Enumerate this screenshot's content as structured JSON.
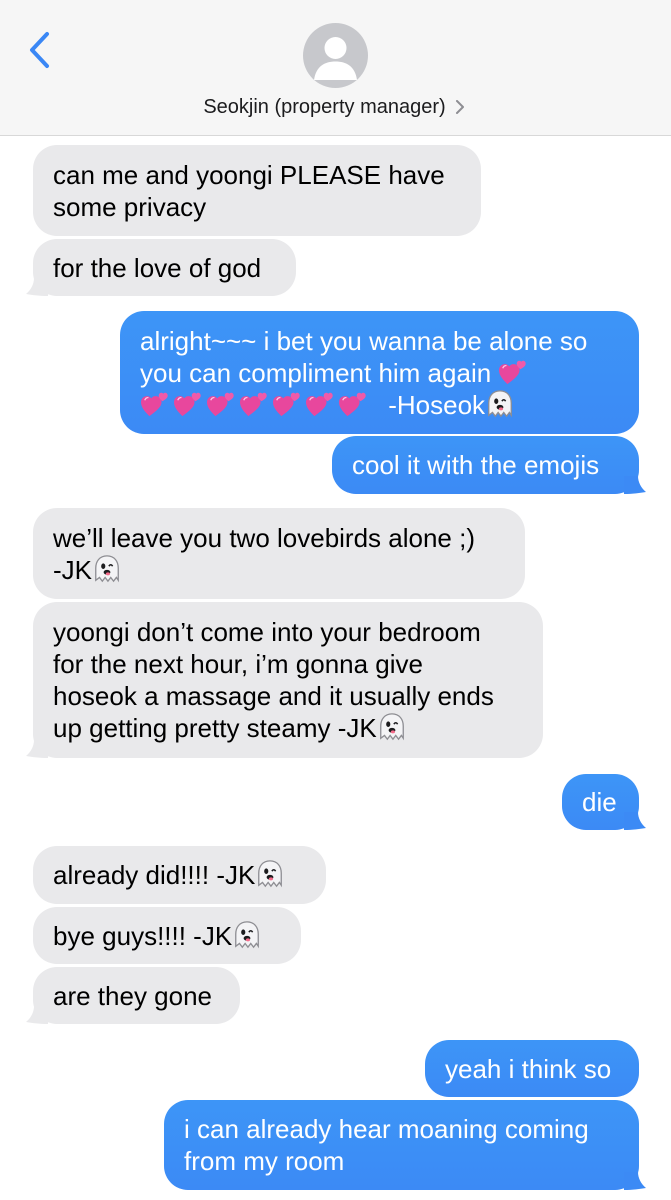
{
  "header": {
    "contact_name": "Seokjin (property manager)",
    "icons": {
      "back": "chevron-left-icon",
      "avatar": "person-silhouette-icon",
      "details": "chevron-right-icon"
    }
  },
  "colors": {
    "incoming": "#e9e9eb",
    "outgoing": "#3d8df5",
    "accent": "#3a87f5"
  },
  "messages": [
    {
      "dir": "in",
      "lines": [
        "can me and yoongi PLEASE have",
        "some privacy"
      ]
    },
    {
      "dir": "in",
      "lines": [
        "for the love of god"
      ]
    },
    {
      "dir": "out",
      "lines": [
        "alright~~~ i bet you wanna be alone so",
        "you can compliment him again"
      ],
      "tail_text": "-Hoseok",
      "emoji": [
        "two-hearts-icon",
        "ghost-icon"
      ]
    },
    {
      "dir": "out",
      "lines": [
        "cool it with the emojis"
      ]
    },
    {
      "dir": "in",
      "lines": [
        "we’ll leave you two lovebirds alone ;)",
        "-JK"
      ],
      "emoji": [
        "ghost-icon"
      ]
    },
    {
      "dir": "in",
      "lines": [
        "yoongi don’t come into your bedroom",
        "for the next hour, i’m gonna give",
        "hoseok a massage and it usually ends",
        "up getting pretty steamy -JK"
      ],
      "emoji": [
        "ghost-icon"
      ]
    },
    {
      "dir": "out",
      "lines": [
        "die"
      ]
    },
    {
      "dir": "in",
      "lines": [
        "already did!!!! -JK"
      ],
      "emoji": [
        "ghost-icon"
      ]
    },
    {
      "dir": "in",
      "lines": [
        "bye guys!!!! -JK"
      ],
      "emoji": [
        "ghost-icon"
      ]
    },
    {
      "dir": "in",
      "lines": [
        "are they gone"
      ]
    },
    {
      "dir": "out",
      "lines": [
        "yeah i think so"
      ]
    },
    {
      "dir": "out",
      "lines": [
        "i can already hear moaning coming",
        "from my room"
      ]
    }
  ]
}
